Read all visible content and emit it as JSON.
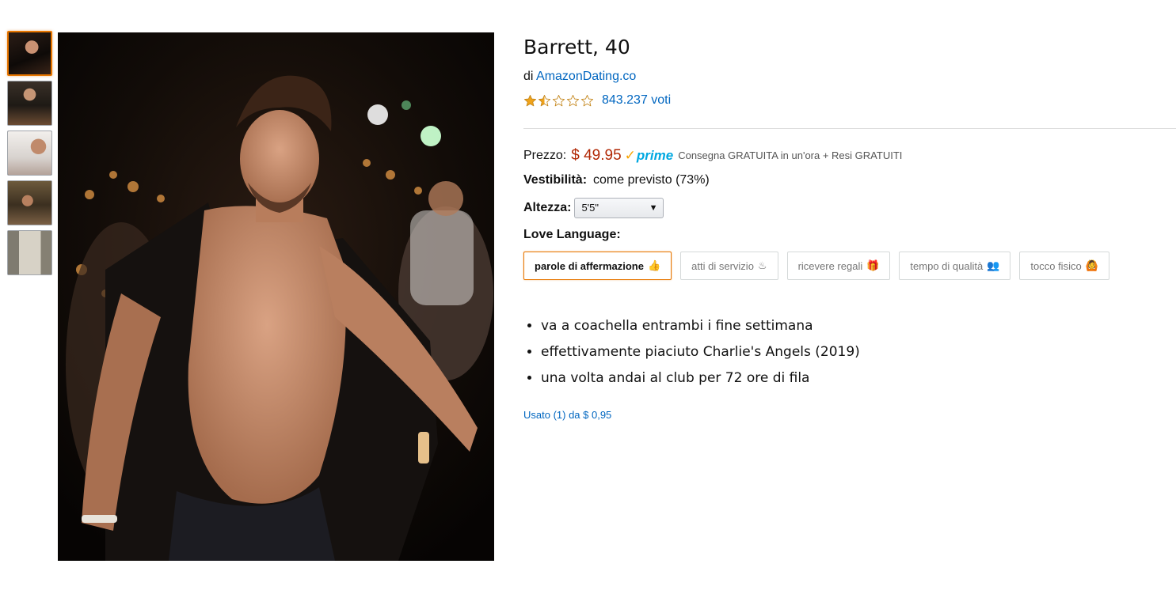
{
  "thumbnails": [
    {
      "alt": "photo-1"
    },
    {
      "alt": "photo-2"
    },
    {
      "alt": "photo-3"
    },
    {
      "alt": "photo-4"
    },
    {
      "alt": "photo-5"
    }
  ],
  "product": {
    "title": "Barrett, 40",
    "by_prefix": "di",
    "brand": "AmazonDating.co",
    "rating_stars": 1.5,
    "rating_max": 5,
    "votes": "843.237 voti"
  },
  "price_block": {
    "label": "Prezzo:",
    "price": "$ 49.95",
    "prime_check": "✓",
    "prime_label": "prime",
    "shipping": "Consegna GRATUITA in un'ora + Resi GRATUITI"
  },
  "fit": {
    "label": "Vestibilità:",
    "value": "come previsto (73%)"
  },
  "height": {
    "label": "Altezza:",
    "selected": "5'5\"",
    "caret": "▼"
  },
  "love_language": {
    "label": "Love Language:",
    "options": [
      {
        "label": "parole di affermazione",
        "emoji": "👍",
        "selected": true
      },
      {
        "label": "atti di servizio",
        "emoji": "♨",
        "selected": false
      },
      {
        "label": "ricevere regali",
        "emoji": "🎁",
        "selected": false
      },
      {
        "label": "tempo di qualità",
        "emoji": "👥",
        "selected": false
      },
      {
        "label": "tocco fisico",
        "emoji": "🙆",
        "selected": false
      }
    ]
  },
  "bullets": [
    "va a coachella entrambi i fine settimana",
    "effettivamente piaciuto Charlie's Angels (2019)",
    "una volta andai al club per 72 ore di fila"
  ],
  "used_offer": "Usato (1) da $ 0,95",
  "colors": {
    "accent": "#e77600",
    "link": "#0066c0",
    "price": "#b12704",
    "star": "#f0a31a"
  }
}
